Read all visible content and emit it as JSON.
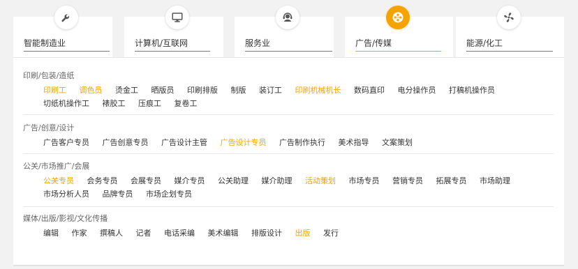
{
  "tabs": [
    {
      "label": "智能制造业",
      "icon": "wrench-icon",
      "active": false
    },
    {
      "label": "计算机/互联网",
      "icon": "monitor-icon",
      "active": false
    },
    {
      "label": "服务业",
      "icon": "customer-service-icon",
      "active": false
    },
    {
      "label": "广告/传媒",
      "icon": "film-reel-icon",
      "active": true
    },
    {
      "label": "能源/化工",
      "icon": "fan-icon",
      "active": false
    }
  ],
  "colors": {
    "accent": "#f5a300",
    "text": "#333333",
    "category_title": "#666666"
  },
  "categories": [
    {
      "title": "印刷/包装/造纸",
      "items": [
        {
          "label": "印刷工",
          "highlight": true
        },
        {
          "label": "调色员",
          "highlight": true
        },
        {
          "label": "烫金工",
          "highlight": false
        },
        {
          "label": "晒版员",
          "highlight": false
        },
        {
          "label": "印刷排版",
          "highlight": false
        },
        {
          "label": "制版",
          "highlight": false
        },
        {
          "label": "装订工",
          "highlight": false
        },
        {
          "label": "印刷机械机长",
          "highlight": true
        },
        {
          "label": "数码直印",
          "highlight": false
        },
        {
          "label": "电分操作员",
          "highlight": false
        },
        {
          "label": "打稿机操作员",
          "highlight": false
        },
        {
          "label": "切纸机操作工",
          "highlight": false
        },
        {
          "label": "裱胶工",
          "highlight": false
        },
        {
          "label": "压痕工",
          "highlight": false
        },
        {
          "label": "复卷工",
          "highlight": false
        }
      ]
    },
    {
      "title": "广告/创意/设计",
      "items": [
        {
          "label": "广告客户专员",
          "highlight": false
        },
        {
          "label": "广告创意专员",
          "highlight": false
        },
        {
          "label": "广告设计主管",
          "highlight": false
        },
        {
          "label": "广告设计专员",
          "highlight": true
        },
        {
          "label": "广告制作执行",
          "highlight": false
        },
        {
          "label": "美术指导",
          "highlight": false
        },
        {
          "label": "文案策划",
          "highlight": false
        }
      ]
    },
    {
      "title": "公关/市场推广/会展",
      "items": [
        {
          "label": "公关专员",
          "highlight": true
        },
        {
          "label": "会务专员",
          "highlight": false
        },
        {
          "label": "会展专员",
          "highlight": false
        },
        {
          "label": "媒介专员",
          "highlight": false
        },
        {
          "label": "公关助理",
          "highlight": false
        },
        {
          "label": "媒介助理",
          "highlight": false
        },
        {
          "label": "活动策划",
          "highlight": true
        },
        {
          "label": "市场专员",
          "highlight": false
        },
        {
          "label": "营销专员",
          "highlight": false
        },
        {
          "label": "拓展专员",
          "highlight": false
        },
        {
          "label": "市场助理",
          "highlight": false
        },
        {
          "label": "市场分析人员",
          "highlight": false
        },
        {
          "label": "品牌专员",
          "highlight": false
        },
        {
          "label": "市场企划专员",
          "highlight": false
        }
      ]
    },
    {
      "title": "媒体/出版/影视/文化传播",
      "items": [
        {
          "label": "编辑",
          "highlight": false
        },
        {
          "label": "作家",
          "highlight": false
        },
        {
          "label": "撰稿人",
          "highlight": false
        },
        {
          "label": "记者",
          "highlight": false
        },
        {
          "label": "电话采编",
          "highlight": false
        },
        {
          "label": "美术编辑",
          "highlight": false
        },
        {
          "label": "排版设计",
          "highlight": false
        },
        {
          "label": "出版",
          "highlight": true
        },
        {
          "label": "发行",
          "highlight": false
        }
      ]
    }
  ]
}
